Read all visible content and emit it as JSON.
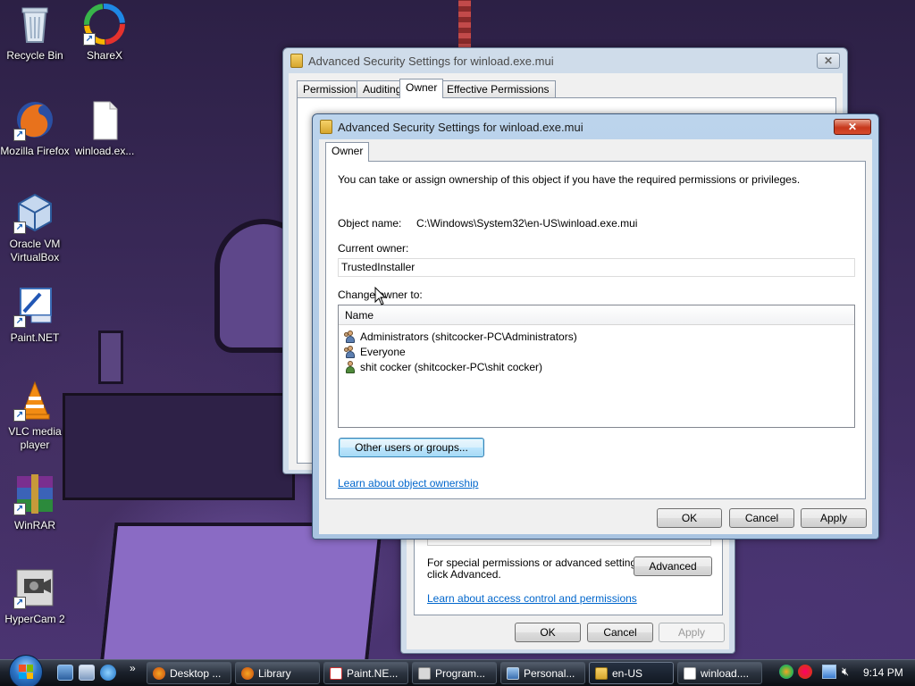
{
  "desktop": {
    "icons": [
      {
        "label": "Recycle Bin",
        "icon": "recycle-bin-icon"
      },
      {
        "label": "ShareX",
        "icon": "sharex-icon"
      },
      {
        "label": "Mozilla Firefox",
        "icon": "firefox-icon"
      },
      {
        "label": "winload.ex...",
        "icon": "file-icon"
      },
      {
        "label": "Oracle VM VirtualBox",
        "icon": "virtualbox-icon"
      },
      {
        "label": "Paint.NET",
        "icon": "paintnet-icon"
      },
      {
        "label": "VLC media player",
        "icon": "vlc-icon"
      },
      {
        "label": "WinRAR",
        "icon": "winrar-icon"
      },
      {
        "label": "HyperCam 2",
        "icon": "hypercam-icon"
      }
    ]
  },
  "back_window": {
    "title": "Advanced Security Settings for winload.exe.mui",
    "tabs": [
      "Permissions",
      "Auditing",
      "Owner",
      "Effective Permissions"
    ],
    "selected_tab": "Owner"
  },
  "perm_window": {
    "special_text_line1": "For special permissions or advanced settings,",
    "special_text_line2": "click Advanced.",
    "advanced_button": "Advanced",
    "learn_link": "Learn about access control and permissions",
    "ok": "OK",
    "cancel": "Cancel",
    "apply": "Apply"
  },
  "front_window": {
    "title": "Advanced Security Settings for winload.exe.mui",
    "tab": "Owner",
    "intro": "You can take or assign ownership of this object if you have the required permissions or privileges.",
    "object_name_label": "Object name:",
    "object_name_value": "C:\\Windows\\System32\\en-US\\winload.exe.mui",
    "current_owner_label": "Current owner:",
    "current_owner_value": "TrustedInstaller",
    "change_owner_label": "Change owner to:",
    "list_header": "Name",
    "owners": [
      {
        "name": "Administrators (shitcocker-PC\\Administrators)",
        "icon": "group-icon"
      },
      {
        "name": "Everyone",
        "icon": "group-icon"
      },
      {
        "name": "shit cocker (shitcocker-PC\\shit cocker)",
        "icon": "user-icon"
      }
    ],
    "other_users_button": "Other users or groups...",
    "learn_link": "Learn about object ownership",
    "ok": "OK",
    "cancel": "Cancel",
    "apply": "Apply"
  },
  "taskbar": {
    "buttons": [
      {
        "label": "Desktop ...",
        "icon": "firefox-icon"
      },
      {
        "label": "Library",
        "icon": "firefox-icon"
      },
      {
        "label": "Paint.NE...",
        "icon": "paintnet-icon"
      },
      {
        "label": "Program...",
        "icon": "program-icon"
      },
      {
        "label": "Personal...",
        "icon": "personalize-icon"
      },
      {
        "label": "en-US",
        "icon": "folder-icon"
      },
      {
        "label": "winload....",
        "icon": "file-icon"
      }
    ],
    "clock": "9:14 PM",
    "overflow": "»"
  }
}
